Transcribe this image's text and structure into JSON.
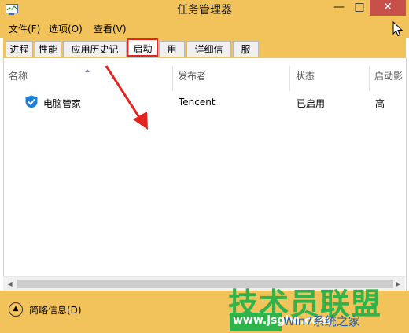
{
  "window": {
    "title": "任务管理器",
    "btn_min": "—",
    "btn_max": "□",
    "btn_close": "✕"
  },
  "menu": [
    "文件(F)",
    "选项(O)",
    "查看(V)"
  ],
  "tabs": [
    {
      "label": "进程"
    },
    {
      "label": "性能"
    },
    {
      "label": "应用历史记录"
    },
    {
      "label": "启动"
    },
    {
      "label": "用户"
    },
    {
      "label": "详细信息"
    },
    {
      "label": "服务"
    }
  ],
  "active_tab": "启动",
  "table": {
    "headers": [
      "名称",
      "发布者",
      "状态",
      "启动影"
    ],
    "rows": [
      {
        "name": "电脑管家",
        "publisher": "Tencent",
        "status": "已启用",
        "impact": "高"
      }
    ]
  },
  "footer": {
    "less_details": "简略信息(D)"
  },
  "watermark": {
    "main": "技术员联盟",
    "url": "www.jsgho.com",
    "suffix": "Win7系统之家"
  },
  "colors": {
    "accent": "#f2c35a",
    "annotation": "#e5231e",
    "close_button": "#c7514a",
    "watermark_green": "#2fb34a"
  }
}
